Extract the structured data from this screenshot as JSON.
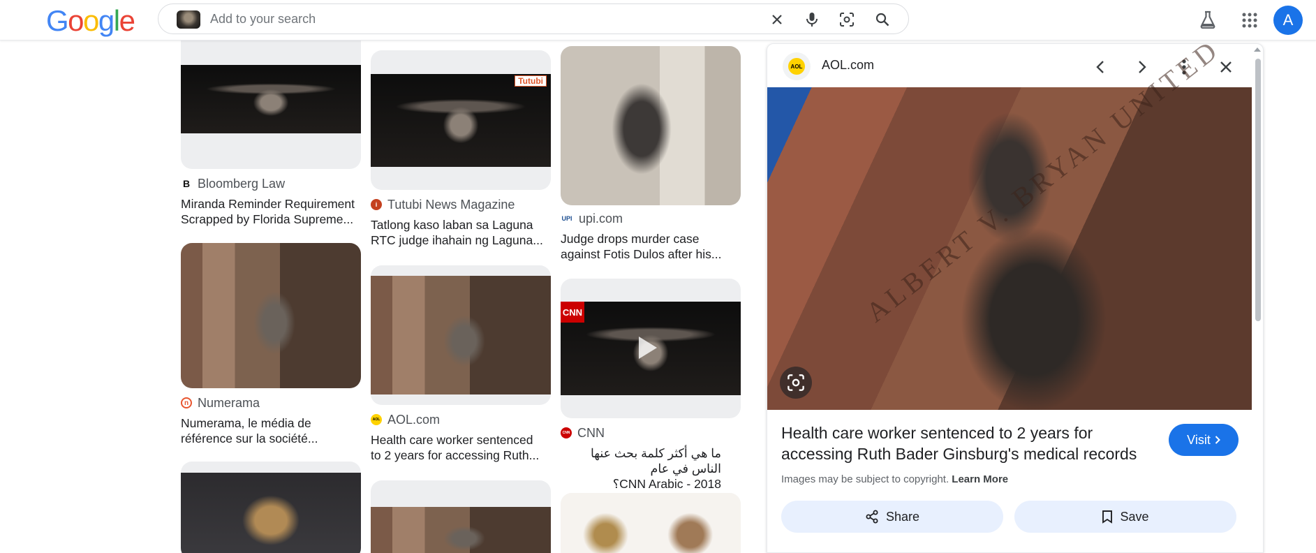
{
  "header": {
    "logo_letters": [
      "G",
      "o",
      "o",
      "g",
      "l",
      "e"
    ],
    "search": {
      "placeholder": "Add to your search",
      "value": ""
    },
    "icons": [
      "close-icon",
      "microphone-icon",
      "lens-icon",
      "search-icon",
      "labs-flask-icon",
      "apps-grid-icon"
    ],
    "avatar_letter": "A"
  },
  "results": [
    {
      "source": "Bloomberg Law",
      "favicon": "B",
      "title_lines": [
        "Miranda Reminder Requirement",
        "Scrapped by Florida Supreme..."
      ]
    },
    {
      "source": "Tutubi News Magazine",
      "favicon": "i",
      "badge": "Tutubi",
      "title_lines": [
        "Tatlong kaso laban sa Laguna",
        "RTC judge ihahain ng Laguna..."
      ]
    },
    {
      "source": "upi.com",
      "favicon": "UPI",
      "title_lines": [
        "Judge drops murder case",
        "against Fotis Dulos after his..."
      ]
    },
    {
      "source": "Numerama",
      "favicon": "n",
      "title_lines": [
        "Numerama, le média de",
        "référence sur la société..."
      ]
    },
    {
      "source": "AOL.com",
      "favicon": "AOL",
      "title_lines": [
        "Health care worker sentenced",
        "to 2 years for accessing Ruth..."
      ]
    },
    {
      "source": "CNN",
      "favicon": "CNN",
      "badge": "CNN",
      "title_lines": [
        "ما هي أكثر كلمة بحث عنها الناس في عام",
        "2018 - CNN Arabic؟"
      ]
    }
  ],
  "panel": {
    "site": "AOL.com",
    "favicon": "AOL",
    "title": "Health care worker sentenced to 2 years for accessing Ruth Bader Ginsburg's medical records",
    "visit_label": "Visit",
    "copyright_text": "Images may be subject to copyright.",
    "learn_more": "Learn More",
    "share_label": "Share",
    "save_label": "Save",
    "engraving": "ALBERT V. BRYAN UNITED"
  },
  "colors": {
    "accent": "#1a73e8",
    "pill_bg": "#e8f0fe",
    "aol_yellow": "#ffd200",
    "cnn_red": "#cc0000"
  }
}
